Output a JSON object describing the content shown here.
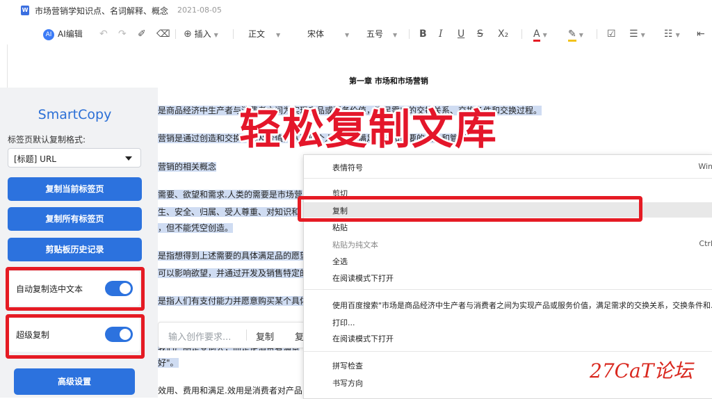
{
  "doc": {
    "icon_letter": "W",
    "title": "市场营销学知识点、名词解释、概念",
    "date": "2021-08-05"
  },
  "toolbar": {
    "ai_badge": "AI",
    "ai_label": "AI编辑",
    "undo": "↶",
    "redo": "↷",
    "format_painter": "✐",
    "eraser": "⌫",
    "insert": "插入",
    "style": "正文",
    "font": "宋体",
    "size": "五号",
    "bold": "B",
    "italic": "I",
    "underline": "U",
    "strike": "S",
    "subscript": "X₂",
    "font_color": "A",
    "highlight": "✎",
    "checklist": "☑",
    "bullet_list": "☰",
    "number_list": "☷",
    "indent": "⇤"
  },
  "document": {
    "chapter": "第一章 市场和市场营销",
    "lines": [
      "是商品经济中生产者与消费者之间为实现产品或服务价值，满足需求的交换关系、交换条件和交换过程。",
      "营销是通过创造和交换产品及价值，从而使个人或群体满足欲望和需要的社会和管理过程。",
      "营销的相关概念",
      "需要、欲望和需求.人类的需要是市场营",
      "生、安全、归属、受人尊重、对知识和",
      "，但不能凭空创造。",
      "是指想得到上述需要的具体满足品的愿望",
      "可以影响欲望，并通过开发及销售特定的",
      "是指人们有支付能力并愿意购买某个具体",
      "我们产品是受何人，而是使消费者满意",
      "好\"。",
      "效用、费用和满足.效用是消费者对产品"
    ],
    "bold_prefix": "营销"
  },
  "banner": "轻松复制文库",
  "smartcopy": {
    "title": "SmartCopy",
    "format_label": "标签页默认复制格式:",
    "format_value": "[标题] URL",
    "btn_copy_current": "复制当前标签页",
    "btn_copy_all": "复制所有标签页",
    "btn_history": "剪贴板历史记录",
    "toggle_auto_label": "自动复制选中文本",
    "toggle_auto_on": true,
    "toggle_super_label": "超级复制",
    "toggle_super_on": true,
    "btn_advanced": "高级设置"
  },
  "prompt": {
    "placeholder": "输入创作要求...",
    "copy": "复制",
    "copy2": "复"
  },
  "context_menu": {
    "items": [
      {
        "label": "表情符号",
        "shortcut": "Win"
      },
      {
        "label": "剪切",
        "shortcut": ""
      },
      {
        "label": "复制",
        "shortcut": ""
      },
      {
        "label": "粘贴",
        "shortcut": ""
      },
      {
        "label": "粘贴为纯文本",
        "shortcut": "Ctrl"
      },
      {
        "label": "全选",
        "shortcut": ""
      },
      {
        "label": "在阅读模式下打开",
        "shortcut": ""
      },
      {
        "label": "使用百度搜索\"市场是商品经济中生产者与消费者之间为实现产品或服务价值，满足需求的交换关系，交换条件和...",
        "shortcut": ""
      },
      {
        "label": "打印...",
        "shortcut": ""
      },
      {
        "label": "在阅读模式下打开",
        "shortcut": ""
      },
      {
        "label": "拼写检查",
        "shortcut": ""
      },
      {
        "label": "书写方向",
        "shortcut": ""
      }
    ]
  },
  "watermark": "27CaT论坛",
  "colors": {
    "accent_blue": "#2c72de",
    "highlight_red": "#e51b24",
    "selection": "#cfdcf2"
  }
}
